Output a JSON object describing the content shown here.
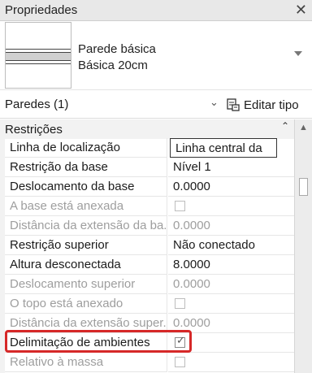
{
  "panel": {
    "title": "Propriedades",
    "close_icon": "close-icon"
  },
  "type_selector": {
    "name": "Parede básica",
    "subtype": "Básica 20cm"
  },
  "filter": {
    "label": "Paredes (1)",
    "edit_type_label": "Editar tipo"
  },
  "group": {
    "label": "Restrições",
    "collapse_glyph": "⌃"
  },
  "rows": [
    {
      "name": "Linha de localização",
      "value": "Linha central da",
      "kind": "text",
      "disabled": false
    },
    {
      "name": "Restrição da base",
      "value": "Nível 1",
      "kind": "text",
      "disabled": false
    },
    {
      "name": "Deslocamento da base",
      "value": "0.0000",
      "kind": "text",
      "disabled": false
    },
    {
      "name": "A base está anexada",
      "value": "",
      "kind": "checkbox",
      "checked": false,
      "disabled": true
    },
    {
      "name": "Distância da extensão da ba...",
      "value": "0.0000",
      "kind": "text",
      "disabled": true
    },
    {
      "name": "Restrição superior",
      "value": "Não conectado",
      "kind": "text",
      "disabled": false
    },
    {
      "name": "Altura desconectada",
      "value": "8.0000",
      "kind": "text",
      "disabled": false
    },
    {
      "name": "Deslocamento superior",
      "value": "0.0000",
      "kind": "text",
      "disabled": true
    },
    {
      "name": "O topo está anexado",
      "value": "",
      "kind": "checkbox",
      "checked": false,
      "disabled": true
    },
    {
      "name": "Distância da extensão super...",
      "value": "0.0000",
      "kind": "text",
      "disabled": true
    },
    {
      "name": "Delimitação de ambientes",
      "value": "",
      "kind": "checkbox",
      "checked": true,
      "disabled": false
    },
    {
      "name": "Relativo à massa",
      "value": "",
      "kind": "checkbox",
      "checked": false,
      "disabled": true
    }
  ],
  "highlight_color": "#d62828"
}
